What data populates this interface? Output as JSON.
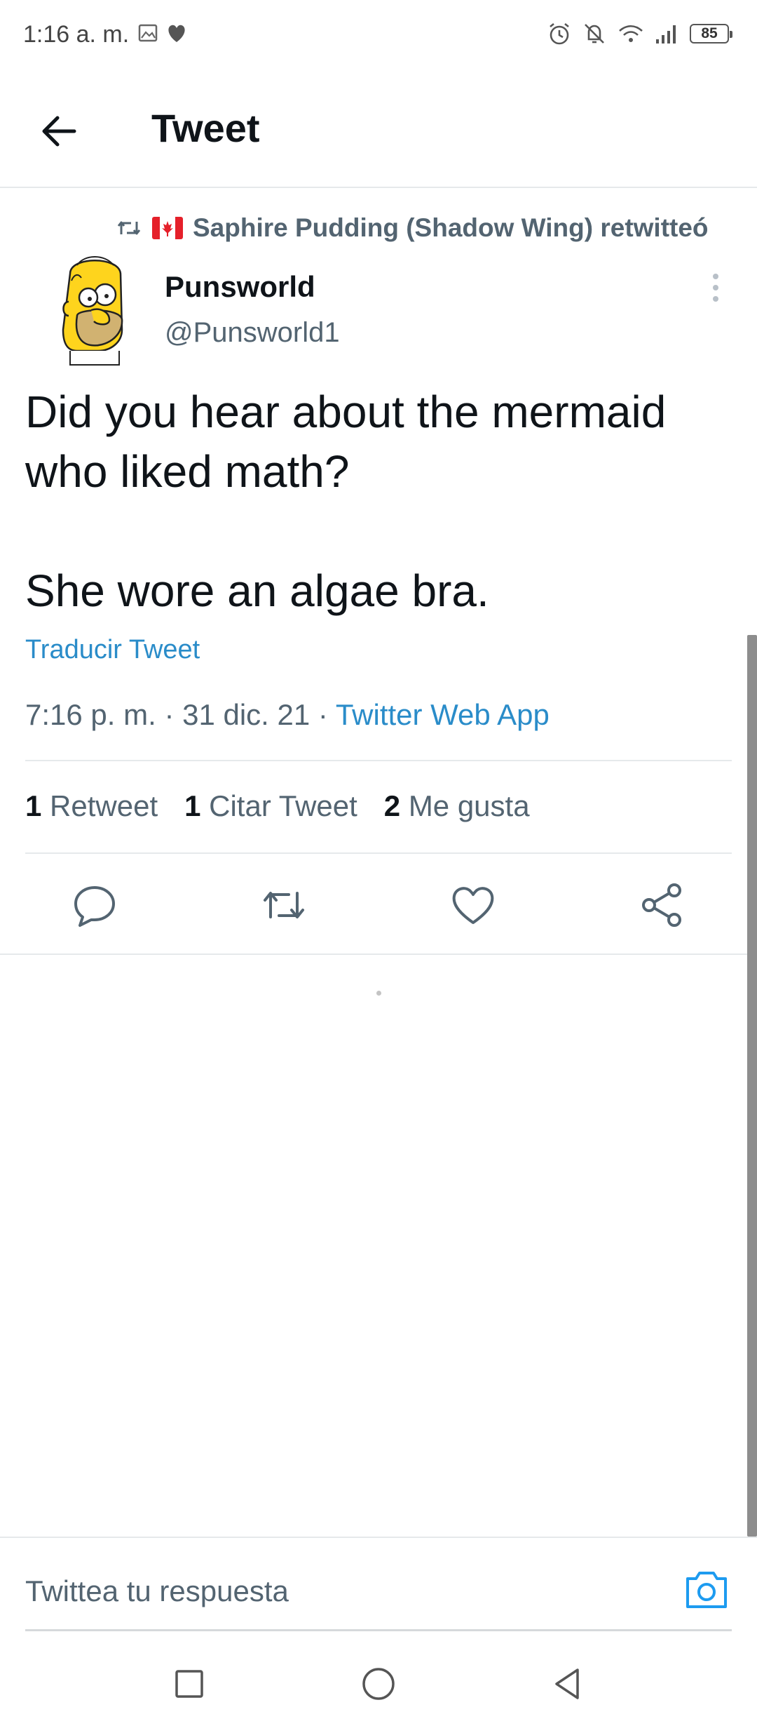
{
  "status_bar": {
    "time": "1:16 a. m.",
    "battery": "85"
  },
  "header": {
    "title": "Tweet"
  },
  "retweet": {
    "text": "Saphire Pudding (Shadow Wing) retwitteó"
  },
  "author": {
    "name": "Punsworld",
    "handle": "@Punsworld1"
  },
  "tweet": {
    "text": "Did you hear about the mermaid\nwho liked math?\n\nShe wore an algae bra.",
    "translate_label": "Traducir Tweet",
    "time": "7:16 p. m.",
    "date": "31 dic. 21",
    "source": "Twitter Web App"
  },
  "stats": {
    "retweets_count": "1",
    "retweets_label": "Retweet",
    "quotes_count": "1",
    "quotes_label": "Citar Tweet",
    "likes_count": "2",
    "likes_label": "Me gusta"
  },
  "reply": {
    "placeholder": "Twittea tu respuesta"
  },
  "colors": {
    "accent": "#1d9bf0",
    "text": "#0f1419",
    "muted": "#536471"
  }
}
